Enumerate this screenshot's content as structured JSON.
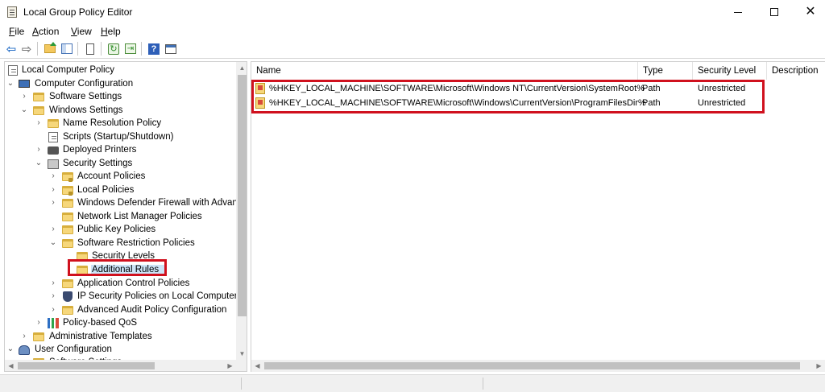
{
  "window": {
    "title": "Local Group Policy Editor",
    "controls": {
      "minimize": "–",
      "maximize": "□",
      "close": "✕"
    }
  },
  "menu": [
    {
      "underline": "F",
      "rest": "ile"
    },
    {
      "underline": "A",
      "rest": "ction"
    },
    {
      "underline": "V",
      "rest": "iew"
    },
    {
      "underline": "H",
      "rest": "elp"
    }
  ],
  "toolbar": {
    "back_glyph": "⇦",
    "forward_glyph": "⇨",
    "refresh_glyph": "↻",
    "export_glyph": "⇥",
    "help_glyph": "?"
  },
  "tree": {
    "chevron_expanded": "⌄",
    "chevron_collapsed": "›",
    "items": [
      {
        "label": "Local Computer Policy",
        "icon": "scroll-icon"
      },
      {
        "label": "Computer Configuration",
        "icon": "computer-icon",
        "state": "expanded"
      },
      {
        "label": "Software Settings",
        "icon": "folder-icon",
        "state": "collapsed"
      },
      {
        "label": "Windows Settings",
        "icon": "folder-icon",
        "state": "expanded"
      },
      {
        "label": "Name Resolution Policy",
        "icon": "folder-icon",
        "state": "collapsed"
      },
      {
        "label": "Scripts (Startup/Shutdown)",
        "icon": "scroll-icon"
      },
      {
        "label": "Deployed Printers",
        "icon": "printer-icon",
        "state": "collapsed"
      },
      {
        "label": "Security Settings",
        "icon": "security-icon",
        "state": "expanded"
      },
      {
        "label": "Account Policies",
        "icon": "locked-folder-icon",
        "state": "collapsed"
      },
      {
        "label": "Local Policies",
        "icon": "locked-folder-icon",
        "state": "collapsed"
      },
      {
        "label": "Windows Defender Firewall with Advanc",
        "icon": "folder-icon",
        "state": "collapsed"
      },
      {
        "label": "Network List Manager Policies",
        "icon": "folder-icon"
      },
      {
        "label": "Public Key Policies",
        "icon": "folder-icon",
        "state": "collapsed"
      },
      {
        "label": "Software Restriction Policies",
        "icon": "folder-icon",
        "state": "expanded"
      },
      {
        "label": "Security Levels",
        "icon": "folder-icon"
      },
      {
        "label": "Additional Rules",
        "icon": "folder-icon",
        "selected": true
      },
      {
        "label": "Application Control Policies",
        "icon": "folder-icon",
        "state": "collapsed"
      },
      {
        "label": "IP Security Policies on Local Computer",
        "icon": "shield-icon",
        "state": "collapsed"
      },
      {
        "label": "Advanced Audit Policy Configuration",
        "icon": "folder-icon",
        "state": "collapsed"
      },
      {
        "label": "Policy-based QoS",
        "icon": "qos-chart-icon",
        "state": "collapsed"
      },
      {
        "label": "Administrative Templates",
        "icon": "folder-icon",
        "state": "collapsed"
      },
      {
        "label": "User Configuration",
        "icon": "user-icon",
        "state": "expanded"
      },
      {
        "label": "Software Settings",
        "icon": "folder-icon",
        "state": "collapsed"
      }
    ]
  },
  "list": {
    "sort_indicator": "^",
    "columns": [
      "Name",
      "Type",
      "Security Level",
      "Description"
    ],
    "rows": [
      {
        "name": "%HKEY_LOCAL_MACHINE\\SOFTWARE\\Microsoft\\Windows NT\\CurrentVersion\\SystemRoot%",
        "type": "Path",
        "level": "Unrestricted",
        "description": ""
      },
      {
        "name": "%HKEY_LOCAL_MACHINE\\SOFTWARE\\Microsoft\\Windows\\CurrentVersion\\ProgramFilesDir%",
        "type": "Path",
        "level": "Unrestricted",
        "description": ""
      }
    ]
  },
  "scroll": {
    "up": "▲",
    "down": "▼",
    "left": "◀",
    "right": "▶"
  },
  "colors": {
    "highlight_box": "#d0111e",
    "selection": "#cce4f7",
    "folder": "#f6d77b"
  }
}
